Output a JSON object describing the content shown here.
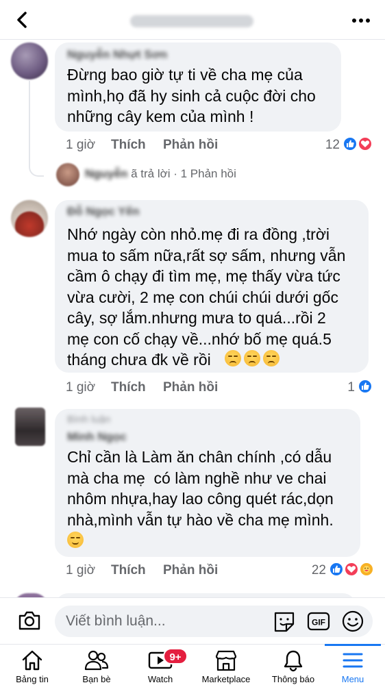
{
  "header": {
    "back_icon": "back-chevron-icon",
    "title": "",
    "more_icon": "more-dots-icon"
  },
  "comments": [
    {
      "author": "Nguyễn Nhựt Sơn",
      "text": "Đừng bao giờ tự ti về cha mẹ của\nmình,họ đã hy sinh cả cuộc đời cho\nnhững cây kem của mình !",
      "time": "1 giờ",
      "like_label": "Thích",
      "reply_label": "Phản hồi",
      "reaction_count": "12",
      "reactions": [
        "like",
        "love"
      ]
    },
    {
      "author": "Đỗ Ngọc Yến",
      "text": "Nhớ ngày còn nhỏ.mẹ đi ra đồng ,trời\nmua to sấm nữa,rất sợ sấm, nhưng vẫn\ncầm ô chạy đi tìm mẹ, mẹ thấy vừa tức\nvừa cười, 2 mẹ con chúi chúi dưới gốc\ncây, sợ lắm.nhưng mưa to quá...rồi 2\nmẹ con cố chạy về...nhớ bố mẹ quá.5\ntháng chưa đk về rồi",
      "emojis": [
        "sad",
        "sad",
        "sad"
      ],
      "time": "1 giờ",
      "like_label": "Thích",
      "reply_label": "Phản hồi",
      "reaction_count": "1",
      "reactions": [
        "like"
      ]
    },
    {
      "author_top": "Bình luận",
      "author": "Minh Ngọc",
      "text": "Chỉ cần là Làm ăn chân chính ,có dẫu\nmà cha mẹ  có làm nghề như ve chai\nnhôm nhựa,hay lao công quét rác,dọn\nnhà,mình vẫn tự hào về cha mẹ mình.",
      "emojis": [
        "smile"
      ],
      "time": "1 giờ",
      "like_label": "Thích",
      "reply_label": "Phản hồi",
      "reaction_count": "22",
      "reactions": [
        "like",
        "love",
        "care"
      ]
    }
  ],
  "reply_summary": {
    "name": "Nguyễn",
    "suffix": "ã trả lời · 1 Phản hồi"
  },
  "composer": {
    "placeholder": "Viết bình luận...",
    "camera_icon": "camera-icon",
    "sticker_icon": "sticker-icon",
    "gif_icon": "gif-icon",
    "emoji_icon": "emoji-icon"
  },
  "tabbar": {
    "tabs": [
      {
        "label": "Bảng tin",
        "icon": "home-icon"
      },
      {
        "label": "Bạn bè",
        "icon": "friends-icon"
      },
      {
        "label": "Watch",
        "icon": "watch-icon",
        "badge": "9+"
      },
      {
        "label": "Marketplace",
        "icon": "marketplace-icon"
      },
      {
        "label": "Thông báo",
        "icon": "bell-icon"
      },
      {
        "label": "Menu",
        "icon": "menu-icon",
        "active": true
      }
    ]
  },
  "colors": {
    "accent": "#1877f2",
    "bubble": "#f0f2f5",
    "meta_text": "#65676b",
    "love": "#f33e58",
    "badge": "#e41e3f"
  }
}
